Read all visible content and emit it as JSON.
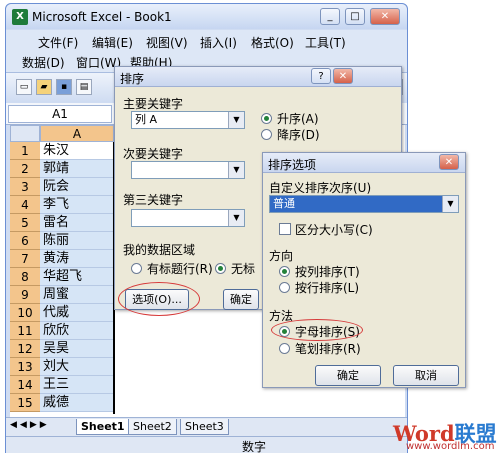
{
  "window": {
    "title": "Microsoft Excel - Book1"
  },
  "menu": {
    "row1": [
      "文件(F)",
      "编辑(E)",
      "视图(V)",
      "插入(I)",
      "格式(O)",
      "工具(T)"
    ],
    "row2": [
      "数据(D)",
      "窗口(W)",
      "帮助(H)"
    ]
  },
  "namebox": "A1",
  "grid": {
    "column_header": "A",
    "rows": [
      {
        "num": "1",
        "name": "朱汉"
      },
      {
        "num": "2",
        "name": "郭靖"
      },
      {
        "num": "3",
        "name": "阮会"
      },
      {
        "num": "4",
        "name": "李飞"
      },
      {
        "num": "5",
        "name": "雷名"
      },
      {
        "num": "6",
        "name": "陈丽"
      },
      {
        "num": "7",
        "name": "黄涛"
      },
      {
        "num": "8",
        "name": "华超飞"
      },
      {
        "num": "9",
        "name": "周蜜"
      },
      {
        "num": "10",
        "name": "代威"
      },
      {
        "num": "11",
        "name": "欣欣"
      },
      {
        "num": "12",
        "name": "吴昊"
      },
      {
        "num": "13",
        "name": "刘大"
      },
      {
        "num": "14",
        "name": "王三"
      },
      {
        "num": "15",
        "name": "威德"
      }
    ]
  },
  "sheet_tabs": [
    "Sheet1",
    "Sheet2",
    "Sheet3"
  ],
  "status": "数字",
  "sort_dialog": {
    "title": "排序",
    "primary_key_label": "主要关键字",
    "primary_key_value": "列 A",
    "asc_label": "升序(A)",
    "desc_label": "降序(D)",
    "secondary_key_label": "次要关键字",
    "tertiary_key_label": "第三关键字",
    "data_range_label": "我的数据区域",
    "has_header_label": "有标题行(R)",
    "no_header_label": "无标",
    "options_button": "选项(O)...",
    "ok_button": "确定"
  },
  "options_dialog": {
    "title": "排序选项",
    "custom_order_label": "自定义排序次序(U)",
    "custom_order_value": "普通",
    "case_sensitive_label": "区分大小写(C)",
    "direction_label": "方向",
    "by_column_label": "按列排序(T)",
    "by_row_label": "按行排序(L)",
    "method_label": "方法",
    "alpha_label": "字母排序(S)",
    "stroke_label": "笔划排序(R)",
    "ok_button": "确定",
    "cancel_button": "取消"
  },
  "watermark": {
    "word": "Word",
    "cn": "联盟",
    "url": "www.wordlm.com"
  }
}
